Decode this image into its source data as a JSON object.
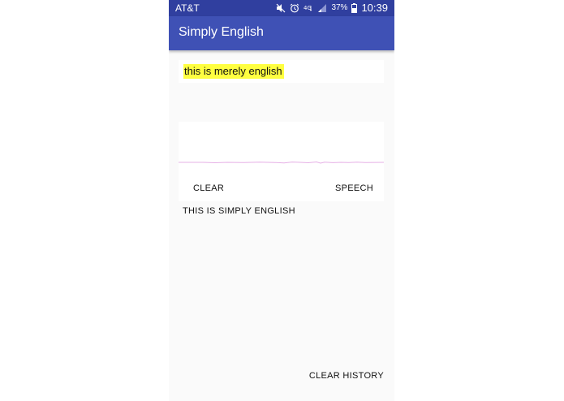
{
  "status_bar": {
    "carrier": "AT&T",
    "icons": [
      "mute-icon",
      "alarm-icon",
      "4g-lte-icon",
      "signal-icon",
      "battery-icon"
    ],
    "battery_percent": "37%",
    "time": "10:39"
  },
  "app_bar": {
    "title": "Simply English"
  },
  "input": {
    "text": "this is merely english",
    "highlight_color": "#ffff40"
  },
  "waveform": {
    "color": "#e6b0e6"
  },
  "controls": {
    "clear_label": "CLEAR",
    "speech_label": "SPEECH"
  },
  "result": {
    "text": "THIS IS SIMPLY ENGLISH"
  },
  "footer": {
    "clear_history_label": "CLEAR HISTORY"
  },
  "colors": {
    "primary": "#3f51b5",
    "primary_dark": "#303f9f",
    "background": "#fafafa"
  }
}
